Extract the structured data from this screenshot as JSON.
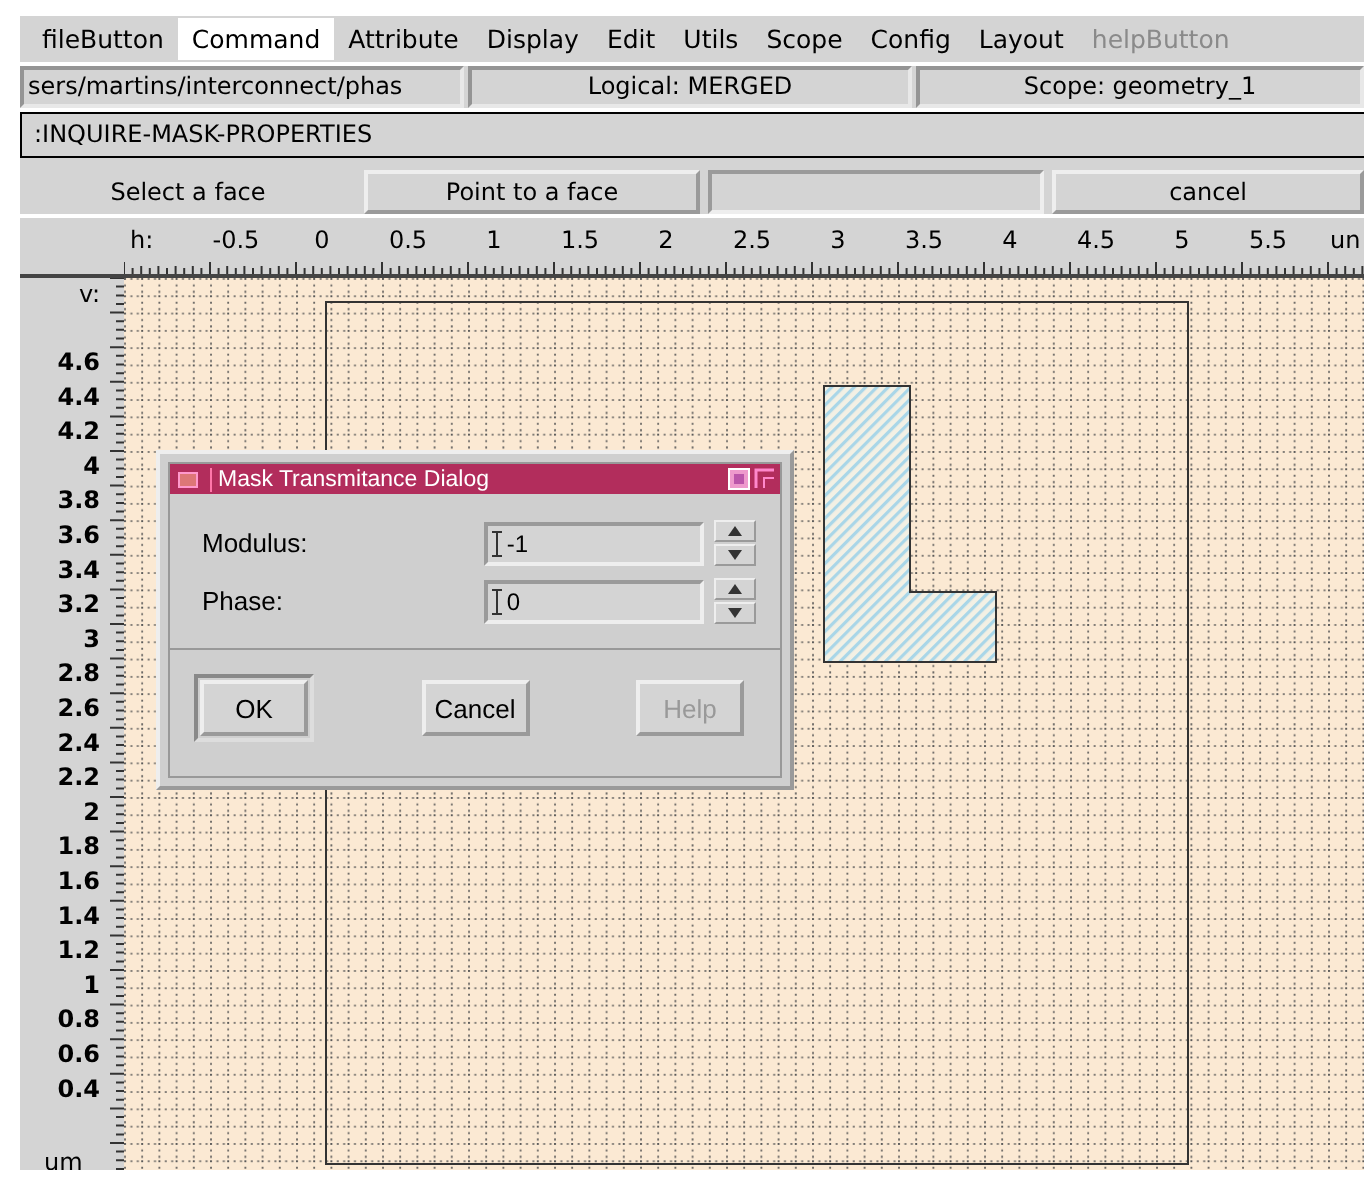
{
  "menu_bar": [
    {
      "label": "fileButton",
      "selected": false,
      "disabled": false
    },
    {
      "label": "Command",
      "selected": true,
      "disabled": false
    },
    {
      "label": "Attribute",
      "selected": false,
      "disabled": false
    },
    {
      "label": "Display",
      "selected": false,
      "disabled": false
    },
    {
      "label": "Edit",
      "selected": false,
      "disabled": false
    },
    {
      "label": "Utils",
      "selected": false,
      "disabled": false
    },
    {
      "label": "Scope",
      "selected": false,
      "disabled": false
    },
    {
      "label": "Config",
      "selected": false,
      "disabled": false
    },
    {
      "label": "Layout",
      "selected": false,
      "disabled": false
    },
    {
      "label": "helpButton",
      "selected": false,
      "disabled": true
    }
  ],
  "status_bar": {
    "path": "sers/martins/interconnect/phas",
    "logical": "Logical: MERGED",
    "scope": "Scope: geometry_1"
  },
  "command_line": ":INQUIRE-MASK-PROPERTIES",
  "prompt_row": [
    {
      "kind": "label",
      "label": "Select a face"
    },
    {
      "kind": "button",
      "label": "Point to a face"
    },
    {
      "kind": "blank"
    },
    {
      "kind": "button",
      "label": "cancel"
    }
  ],
  "h_ruler": {
    "axis": "h:",
    "ticks": [
      "-0.5",
      "0",
      "0.5",
      "1",
      "1.5",
      "2",
      "2.5",
      "3",
      "3.5",
      "4",
      "4.5",
      "5",
      "5.5"
    ],
    "unit": "un"
  },
  "v_ruler": {
    "axis": "v:",
    "ticks": [
      "4.6",
      "4.4",
      "4.2",
      "4",
      "3.8",
      "3.6",
      "3.4",
      "3.2",
      "3",
      "2.8",
      "2.6",
      "2.4",
      "2.2",
      "2",
      "1.8",
      "1.6",
      "1.4",
      "1.2",
      "1",
      "0.8",
      "0.6",
      "0.4"
    ],
    "unit": "um"
  },
  "dialog": {
    "title": "Mask Transmitance Dialog",
    "fields": [
      {
        "label": "Modulus:",
        "value": "-1"
      },
      {
        "label": "Phase:",
        "value": "0"
      }
    ],
    "buttons": [
      {
        "label": "OK",
        "default": true,
        "disabled": false
      },
      {
        "label": "Cancel",
        "default": false,
        "disabled": false
      },
      {
        "label": "Help",
        "default": false,
        "disabled": true
      }
    ]
  }
}
